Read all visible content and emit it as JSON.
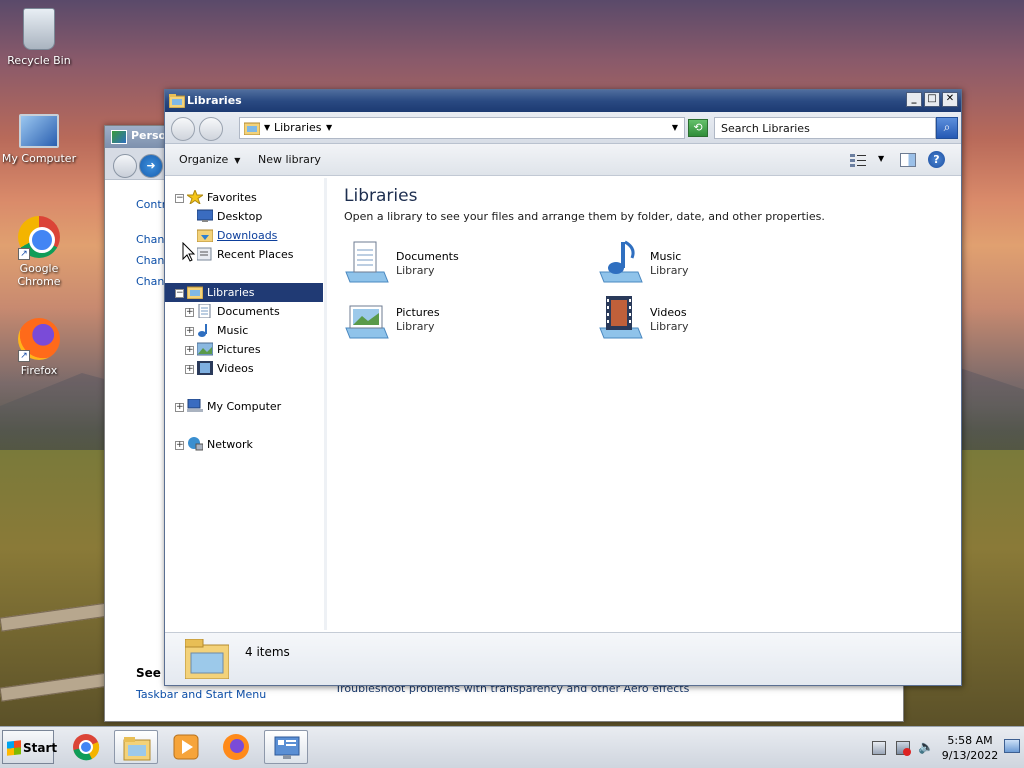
{
  "desktop": {
    "icons": [
      {
        "label": "Recycle Bin",
        "icon": "recycle-bin-icon"
      },
      {
        "label": "My Computer",
        "icon": "computer-icon"
      },
      {
        "label": "Google Chrome",
        "icon": "chrome-icon"
      },
      {
        "label": "Firefox",
        "icon": "firefox-icon"
      }
    ]
  },
  "back_window": {
    "title": "Person",
    "links": [
      "Contr",
      "Chang",
      "Chang",
      "Chang"
    ],
    "see_also": "See a",
    "taskbar_link": "Taskbar and Start Menu",
    "troubleshoot": "Troubleshoot problems with transparency and other Aero effects"
  },
  "window": {
    "title": "Libraries",
    "address": {
      "crumb": "Libraries"
    },
    "search": {
      "placeholder": "Search Libraries"
    },
    "toolbar": {
      "organize": "Organize",
      "new_library": "New library"
    },
    "nav": {
      "favorites": "Favorites",
      "desktop": "Desktop",
      "downloads": "Downloads",
      "recent": "Recent Places",
      "libraries": "Libraries",
      "documents": "Documents",
      "music": "Music",
      "pictures": "Pictures",
      "videos": "Videos",
      "my_computer": "My Computer",
      "network": "Network"
    },
    "content": {
      "heading": "Libraries",
      "subtitle": "Open a library to see your files and arrange them by folder, date, and other properties.",
      "items": [
        {
          "name": "Documents",
          "type": "Library"
        },
        {
          "name": "Music",
          "type": "Library"
        },
        {
          "name": "Pictures",
          "type": "Library"
        },
        {
          "name": "Videos",
          "type": "Library"
        }
      ]
    },
    "status": {
      "count": "4 items"
    }
  },
  "taskbar": {
    "start": "Start",
    "clock_time": "5:58 AM",
    "clock_date": "9/13/2022"
  }
}
